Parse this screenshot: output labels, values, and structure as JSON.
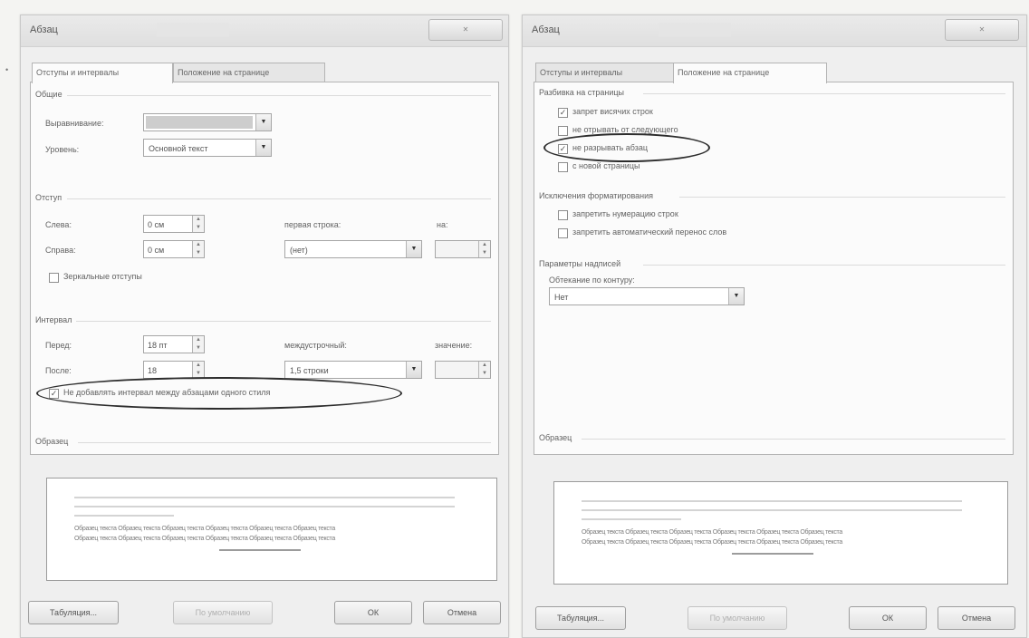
{
  "left": {
    "title": "Абзац",
    "tabs": [
      "Отступы и интервалы",
      "Положение на странице"
    ],
    "general": {
      "section": "Общие",
      "alignment_label": "Выравнивание:",
      "alignment_value": "",
      "level_label": "Уровень:",
      "level_value": "Основной текст"
    },
    "indent": {
      "section": "Отступ",
      "left_label": "Слева:",
      "left_value": "0 см",
      "right_label": "Справа:",
      "right_value": "0 см",
      "first_line_label": "первая строка:",
      "first_line_value": "(нет)",
      "on_label": "на:",
      "on_value": "",
      "mirror_label": "Зеркальные отступы"
    },
    "spacing": {
      "section": "Интервал",
      "before_label": "Перед:",
      "before_value": "18 пт",
      "after_label": "После:",
      "after_value": "18",
      "line_label": "междустрочный:",
      "line_value": "1,5 строки",
      "value_label": "значение:",
      "value_value": "",
      "no_space_label": "Не добавлять интервал между абзацами одного стиля",
      "no_space_checked": true
    },
    "preview": {
      "section": "Образец"
    },
    "buttons": {
      "tabs": "Табуляция...",
      "default": "По умолчанию",
      "ok": "ОК",
      "cancel": "Отмена"
    }
  },
  "right": {
    "title": "Абзац",
    "tabs": [
      "Отступы и интервалы",
      "Положение на странице"
    ],
    "pagination": {
      "section": "Разбивка на страницы",
      "items": [
        {
          "label": "запрет висячих строк",
          "checked": true
        },
        {
          "label": "не отрывать от следующего",
          "checked": false
        },
        {
          "label": "не разрывать абзац",
          "checked": true
        },
        {
          "label": "с новой страницы",
          "checked": false
        }
      ]
    },
    "exceptions": {
      "section": "Исключения форматирования",
      "items": [
        {
          "label": "запретить нумерацию строк",
          "checked": false
        },
        {
          "label": "запретить автоматический перенос слов",
          "checked": false
        }
      ]
    },
    "textbox": {
      "section": "Параметры надписей",
      "wrap_label": "Обтекание по контуру:",
      "wrap_value": "Нет"
    },
    "preview": {
      "section": "Образец"
    },
    "buttons": {
      "tabs": "Табуляция...",
      "default": "По умолчанию",
      "ok": "ОК",
      "cancel": "Отмена"
    }
  },
  "preview_text": "Образец текста Образец текста Образец текста Образец текста Образец текста Образец текста"
}
